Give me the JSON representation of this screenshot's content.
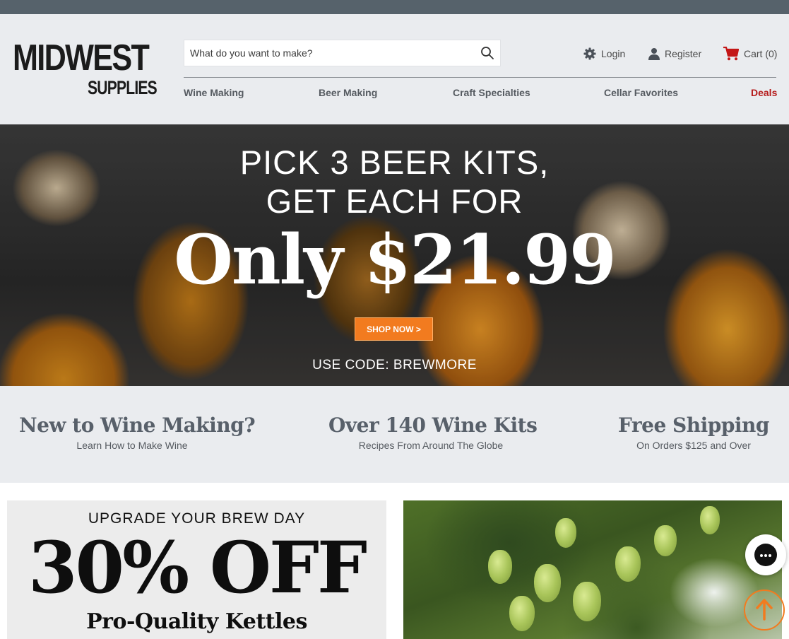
{
  "brand": {
    "logo_line1": "MIDWEST",
    "logo_line2": "SUPPLIES"
  },
  "search": {
    "placeholder": "What do you want to make?",
    "icon": "search-icon"
  },
  "account": {
    "login_label": "Login",
    "register_label": "Register",
    "cart_label": "Cart (0)"
  },
  "nav": {
    "items": [
      {
        "label": "Wine Making"
      },
      {
        "label": "Beer Making"
      },
      {
        "label": "Craft Specialties"
      },
      {
        "label": "Cellar Favorites"
      },
      {
        "label": "Deals"
      }
    ]
  },
  "hero": {
    "line1": "PICK 3 BEER KITS,",
    "line2": "GET EACH FOR",
    "line3": "Only $21.99",
    "cta": "SHOP NOW >",
    "code": "USE CODE: BREWMORE"
  },
  "features": [
    {
      "title": "New to Wine Making?",
      "subtitle": "Learn How to Make Wine"
    },
    {
      "title": "Over 140 Wine Kits",
      "subtitle": "Recipes From Around The Globe"
    },
    {
      "title": "Free Shipping",
      "subtitle": "On Orders $125 and Over"
    }
  ],
  "promo1": {
    "line1": "UPGRADE YOUR BREW DAY",
    "line2": "30% OFF",
    "line3": "Pro-Quality Kettles"
  },
  "colors": {
    "topbar": "#56626b",
    "header_bg": "#eaecef",
    "deals": "#b51b1b",
    "accent_orange": "#f27b1f",
    "feature_text": "#58606a"
  },
  "widgets": {
    "chat_icon": "chat-icon",
    "scroll_top_icon": "arrow-up-icon"
  }
}
